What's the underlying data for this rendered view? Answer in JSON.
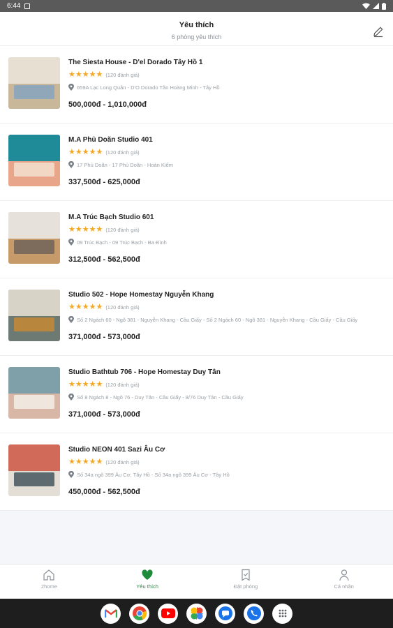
{
  "status_bar": {
    "time": "6:44"
  },
  "header": {
    "title": "Yêu thích",
    "subtitle": "6 phòng yêu thích"
  },
  "items": [
    {
      "name": "The Siesta House - D'el Dorado Tây Hồ 1",
      "rating": 5,
      "reviews": "(120 đánh giá)",
      "address": "659A Lạc Long Quân - D'O Dorado Tân Hoàng Minh - Tây Hồ",
      "price": "500,000đ - 1,010,000đ",
      "thumb_colors": [
        "#c9b79a",
        "#e7dfd2",
        "#8fa7b8"
      ]
    },
    {
      "name": "M.A Phủ Doãn Studio 401",
      "rating": 5,
      "reviews": "(120 đánh giá)",
      "address": "17 Phủ Doãn - 17 Phủ Doãn - Hoàn Kiếm",
      "price": "337,500đ - 625,000đ",
      "thumb_colors": [
        "#e9a58a",
        "#1f8a98",
        "#f2d7c4"
      ]
    },
    {
      "name": "M.A Trúc Bạch Studio 601",
      "rating": 5,
      "reviews": "(120 đánh giá)",
      "address": "09 Trúc Bạch - 09 Trúc Bạch - Ba Đình",
      "price": "312,500đ - 562,500đ",
      "thumb_colors": [
        "#c79a6a",
        "#e6e1da",
        "#7d6b5c"
      ]
    },
    {
      "name": "Studio 502 - Hope Homestay Nguyễn Khang",
      "rating": 5,
      "reviews": "(120 đánh giá)",
      "address": "Số 2 Ngách 60 - Ngõ 381 - Nguyễn Khang - Cầu Giấy - Số 2 Ngách 60 - Ngõ 381 - Nguyễn Khang - Cầu Giấy - Cầu Giấy",
      "price": "371,000đ - 573,000đ",
      "thumb_colors": [
        "#6d7a74",
        "#d8d3c7",
        "#b8863c"
      ]
    },
    {
      "name": "Studio Bathtub 706 - Hope Homestay Duy Tân",
      "rating": 5,
      "reviews": "(120 đánh giá)",
      "address": "Số 8 Ngách 8 - Ngõ 76 - Duy Tân - Cầu Giấy - 8/76 Duy Tân - Cầu Giấy",
      "price": "371,000đ - 573,000đ",
      "thumb_colors": [
        "#d9b7a6",
        "#7fa0a8",
        "#efe6de"
      ]
    },
    {
      "name": "Studio NEON 401 Sazi Âu Cơ",
      "rating": 5,
      "reviews": "(120 đánh giá)",
      "address": "Số 34a ngõ 399 Âu Cơ, Tây Hồ - Số 34a ngõ 399 Âu Cơ - Tây Hồ",
      "price": "450,000đ - 562,500đ",
      "thumb_colors": [
        "#e3ded6",
        "#d26a5a",
        "#5d6b70"
      ]
    }
  ],
  "tabs": [
    {
      "label": "2home",
      "icon": "home-icon",
      "active": false
    },
    {
      "label": "Yêu thích",
      "icon": "heart-icon",
      "active": true
    },
    {
      "label": "Đặt phòng",
      "icon": "booking-icon",
      "active": false
    },
    {
      "label": "Cá nhân",
      "icon": "person-icon",
      "active": false
    }
  ],
  "dock_apps": [
    "gmail-icon",
    "chrome-icon",
    "youtube-icon",
    "photos-icon",
    "messages-icon",
    "phone-icon",
    "apps-icon"
  ],
  "colors": {
    "accent": "#1e8b3a",
    "star": "#f5a623"
  }
}
